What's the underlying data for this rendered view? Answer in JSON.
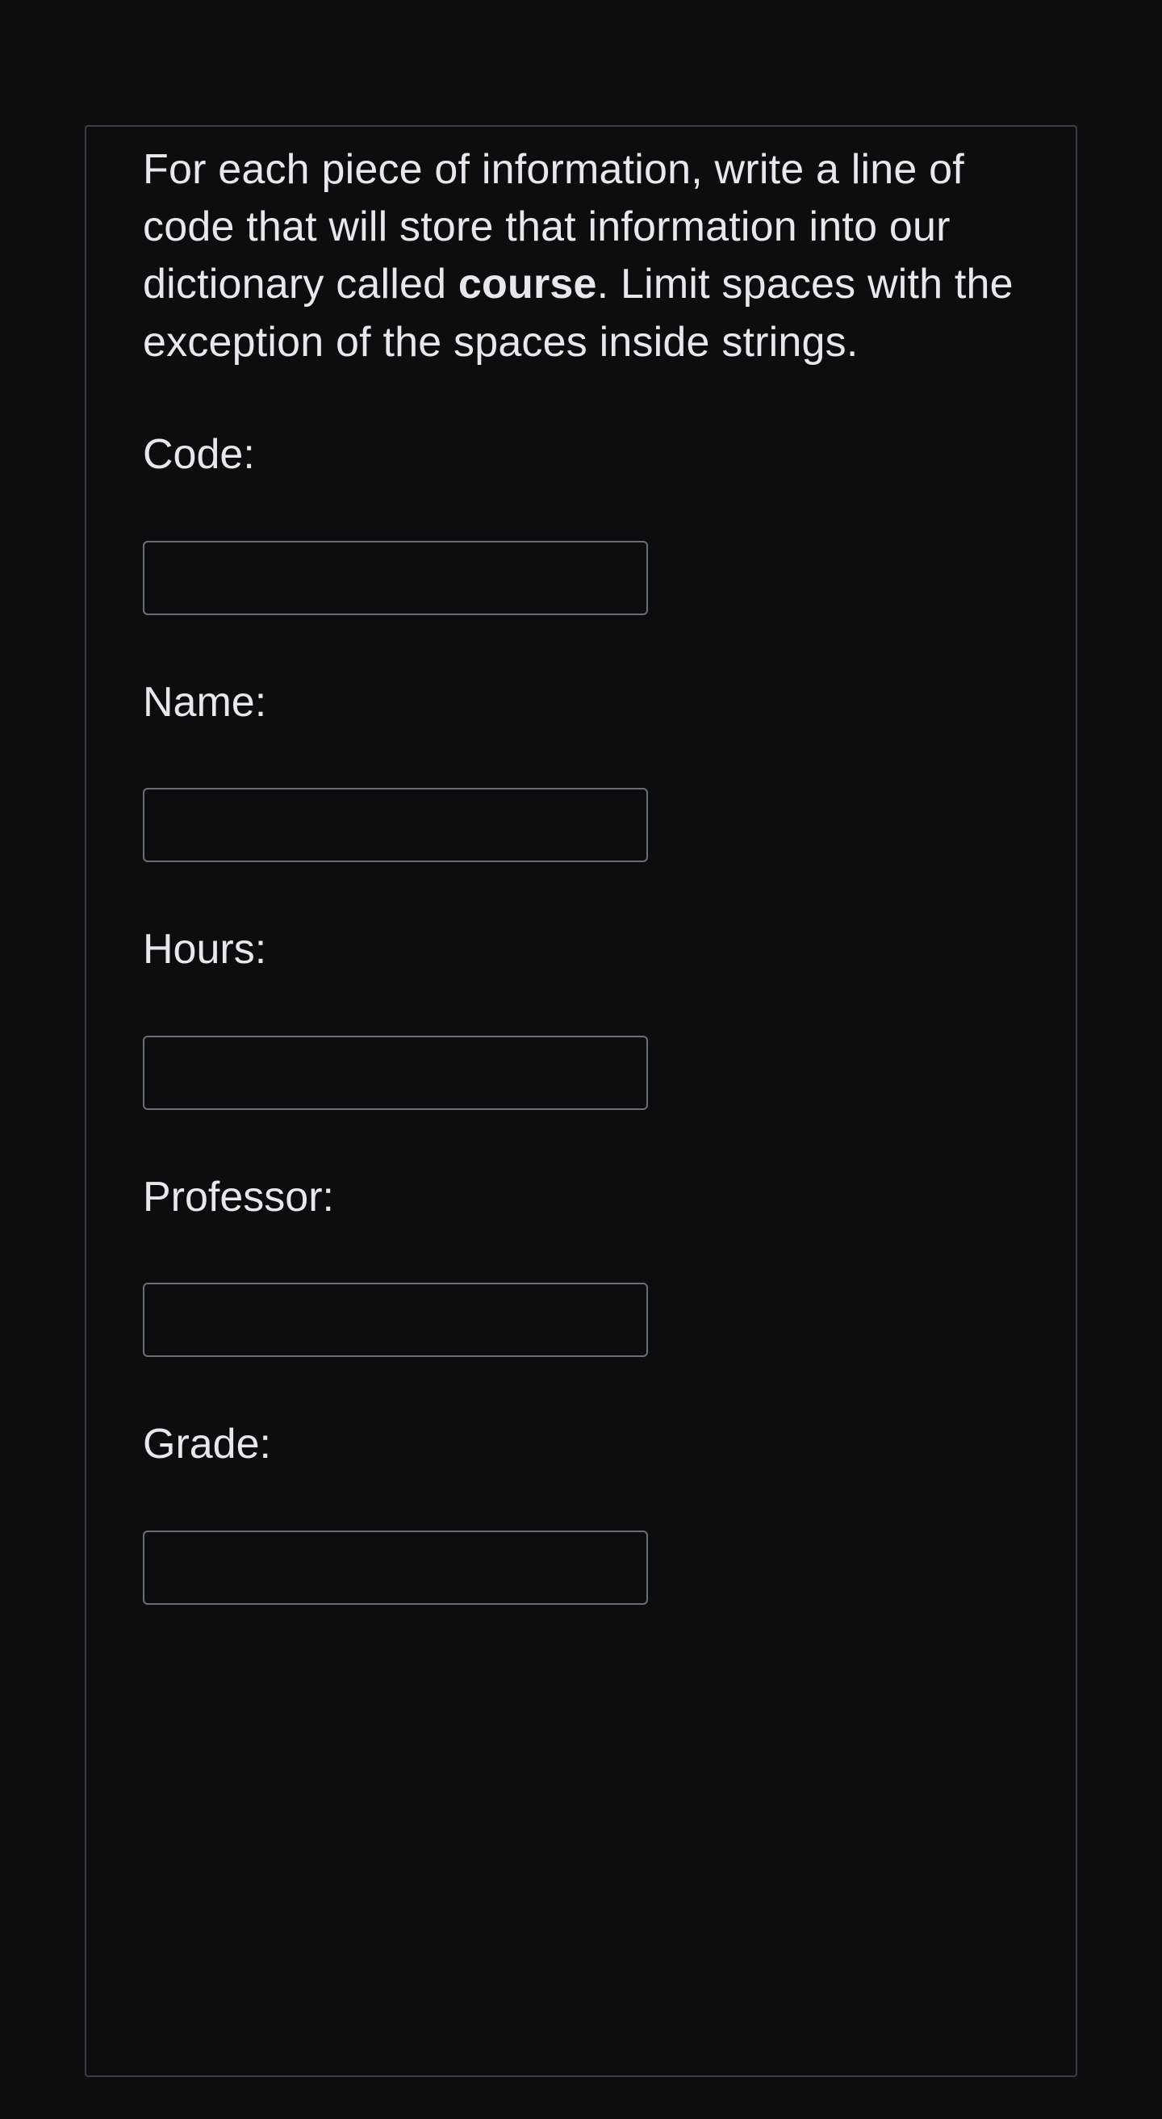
{
  "intro": {
    "part1": "For each piece of information, write a line of code that will store that information into our dictionary called ",
    "bold": "course",
    "part2": ". Limit spaces with the exception of the spaces inside strings."
  },
  "fields": {
    "code": {
      "label": "Code:",
      "value": ""
    },
    "name": {
      "label": "Name:",
      "value": ""
    },
    "hours": {
      "label": "Hours:",
      "value": ""
    },
    "professor": {
      "label": "Professor:",
      "value": ""
    },
    "grade": {
      "label": "Grade:",
      "value": ""
    }
  }
}
